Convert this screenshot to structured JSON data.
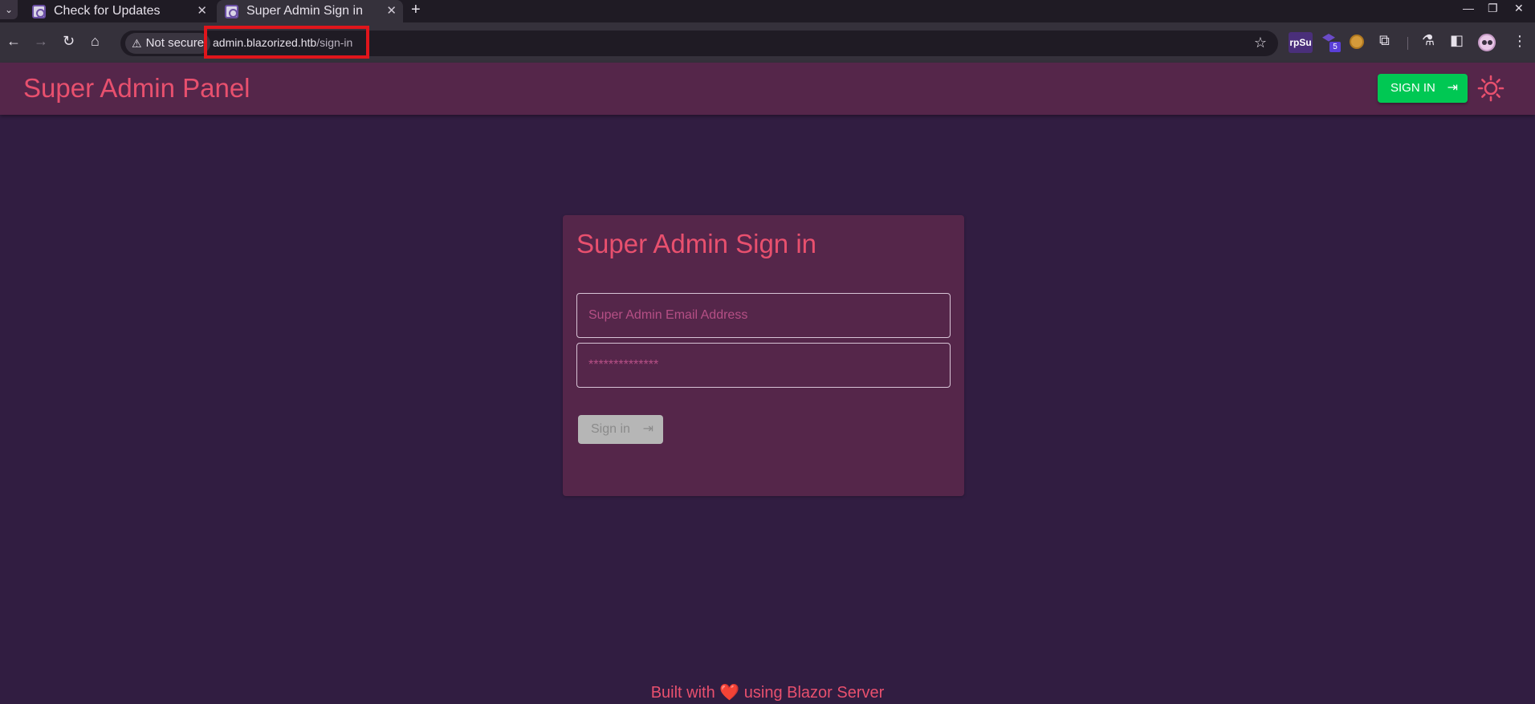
{
  "browser": {
    "tabs": [
      {
        "title": "Check for Updates",
        "active": false
      },
      {
        "title": "Super Admin Sign in",
        "active": true
      }
    ],
    "security_label": "Not secure",
    "url_host": "admin.blazorized.htb",
    "url_path": "/sign-in",
    "extensions": {
      "rpsu_label": "rpSu",
      "badge_count": "5"
    }
  },
  "app": {
    "title": "Super Admin Panel",
    "signin_button_label": "SIGN IN"
  },
  "signin_card": {
    "title": "Super Admin Sign in",
    "email_placeholder": "Super Admin Email Address",
    "password_placeholder": "**************",
    "submit_label": "Sign in"
  },
  "footer": {
    "prefix": "Built with",
    "heart": "❤️",
    "suffix": "using Blazor Server"
  },
  "colors": {
    "page_bg": "#311d41",
    "appbar_bg": "#55264a",
    "accent": "#e8506e",
    "signin_green": "#00c853",
    "url_highlight": "#e0151b"
  }
}
